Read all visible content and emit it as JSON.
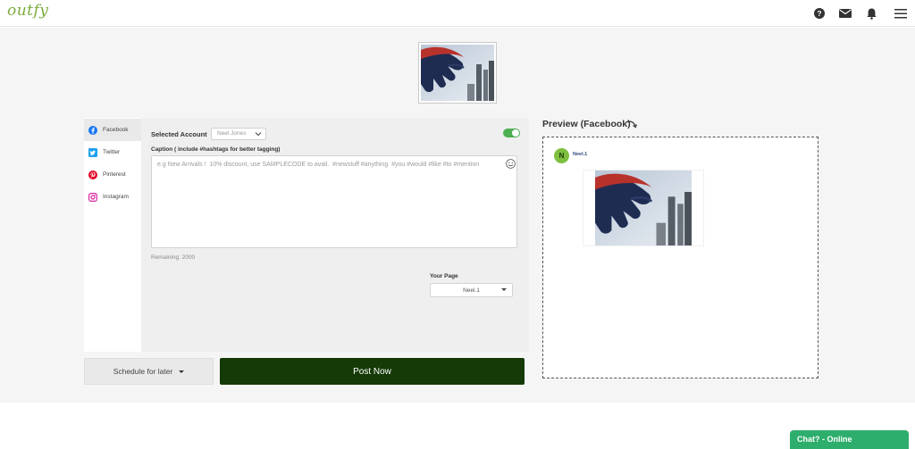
{
  "header": {
    "logo": "outfy",
    "icons": [
      "help-icon",
      "mail-icon",
      "bell-icon",
      "menu-icon"
    ]
  },
  "composer": {
    "networks": [
      {
        "name": "Facebook",
        "icon": "facebook-icon",
        "color": "#1877f2",
        "active": true
      },
      {
        "name": "Twitter",
        "icon": "twitter-icon",
        "color": "#1da1f2",
        "active": false
      },
      {
        "name": "Pinterest",
        "icon": "pinterest-icon",
        "color": "#e60023",
        "active": false
      },
      {
        "name": "Instagram",
        "icon": "instagram-icon",
        "color": "#d6249f",
        "active": false
      }
    ],
    "selected_account_label": "Selected Account",
    "selected_account_value": "Neel Jones",
    "toggle_on": true,
    "caption_label": "Caption ( include #hashtags for better tagging)",
    "caption_value": "",
    "caption_placeholder": "e.g New Arrivals !  10% discount, use SAMPLECODE to avail.  #newstuff #anything  #you #would #like #to #mention",
    "remaining": "Remaining: 2000",
    "your_page_label": "Your Page",
    "your_page_value": "Neel.1"
  },
  "actions": {
    "schedule_label": "Schedule for later",
    "post_label": "Post Now"
  },
  "preview": {
    "title": "Preview (Facebook)",
    "avatar_letter": "N",
    "page_name": "Neel.1"
  },
  "chat": {
    "label": "Chat? - Online"
  },
  "colors": {
    "brand": "#7aab3b",
    "post_button": "#153a07",
    "chat": "#2eae6c",
    "toggle": "#4caf50"
  }
}
